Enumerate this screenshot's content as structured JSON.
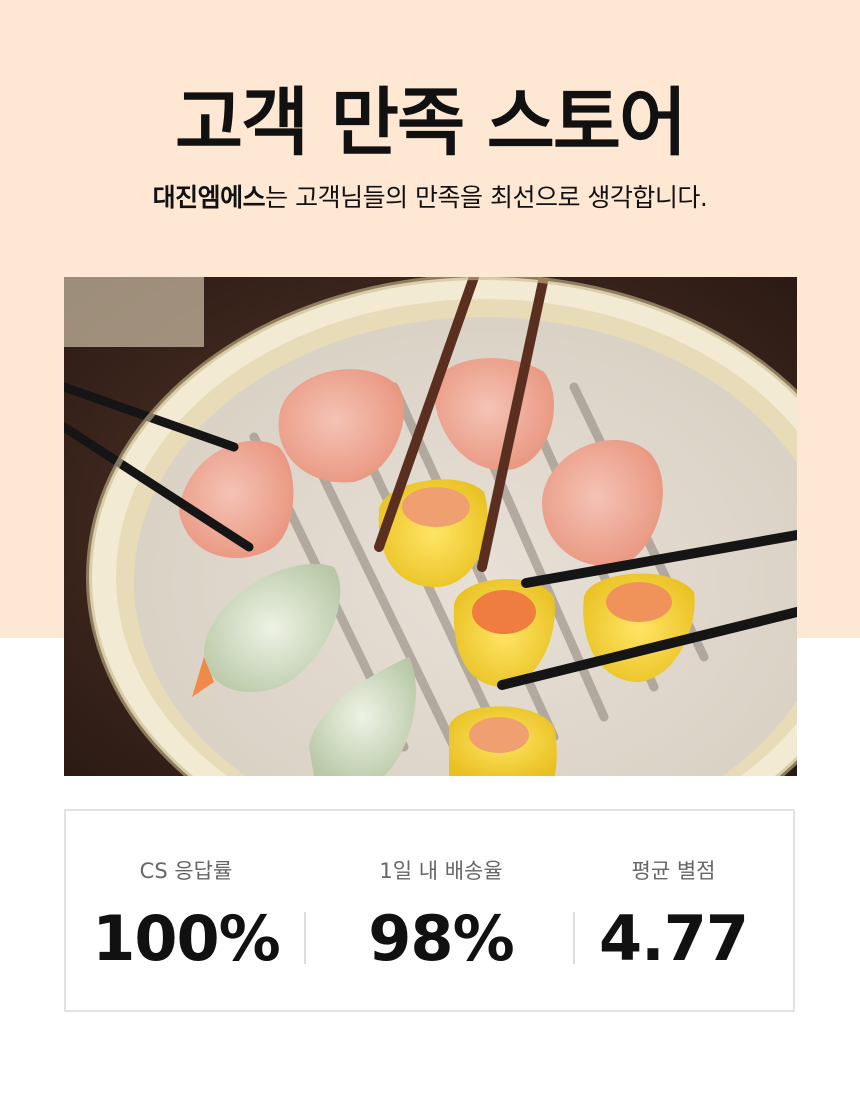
{
  "header": {
    "title": "고객 만족 스토어",
    "subtitle_brand": "대진엠에스",
    "subtitle_rest": "는 고객님들의 만족을 최선으로 생각합니다."
  },
  "stats": [
    {
      "label": "CS 응답률",
      "value": "100%"
    },
    {
      "label": "1일 내 배송율",
      "value": "98%"
    },
    {
      "label": "평균 별점",
      "value": "4.77"
    }
  ],
  "colors": {
    "header_background": "#fee8d3",
    "text": "#111111",
    "label_text": "#666666",
    "border": "#e2e2e2"
  }
}
